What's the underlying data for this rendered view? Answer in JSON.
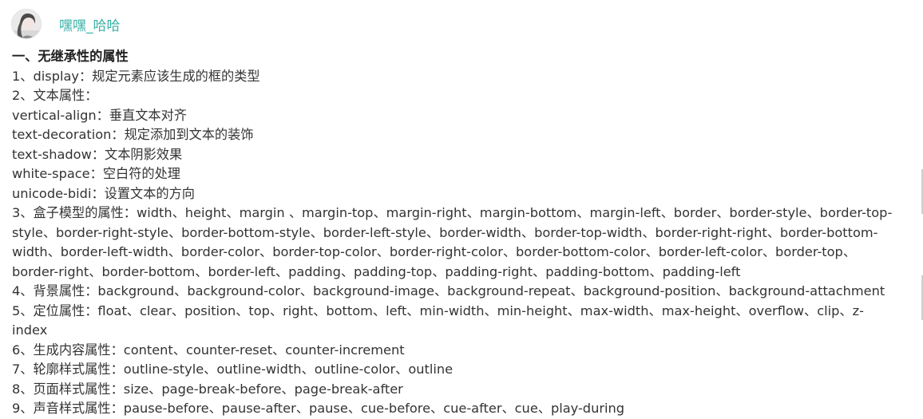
{
  "author": {
    "name": "嘿嘿_哈哈"
  },
  "article": {
    "heading": "一、无继承性的属性",
    "lines": [
      "1、display：规定元素应该生成的框的类型",
      "2、文本属性：",
      "vertical-align：垂直文本对齐",
      "text-decoration：规定添加到文本的装饰",
      "text-shadow：文本阴影效果",
      "white-space：空白符的处理",
      "unicode-bidi：设置文本的方向",
      "3、盒子模型的属性：width、height、margin 、margin-top、margin-right、margin-bottom、margin-left、border、border-style、border-top-style、border-right-style、border-bottom-style、border-left-style、border-width、border-top-width、border-right-right、border-bottom-width、border-left-width、border-color、border-top-color、border-right-color、border-bottom-color、border-left-color、border-top、border-right、border-bottom、border-left、padding、padding-top、padding-right、padding-bottom、padding-left",
      "4、背景属性：background、background-color、background-image、background-repeat、background-position、background-attachment",
      "5、定位属性：float、clear、position、top、right、bottom、left、min-width、min-height、max-width、max-height、overflow、clip、z-index",
      "6、生成内容属性：content、counter-reset、counter-increment",
      "7、轮廓样式属性：outline-style、outline-width、outline-color、outline",
      "8、页面样式属性：size、page-break-before、page-break-after",
      "9、声音样式属性：pause-before、pause-after、pause、cue-before、cue-after、cue、play-during"
    ]
  },
  "colors": {
    "author_link": "#3ab1a6",
    "text": "#333333"
  }
}
